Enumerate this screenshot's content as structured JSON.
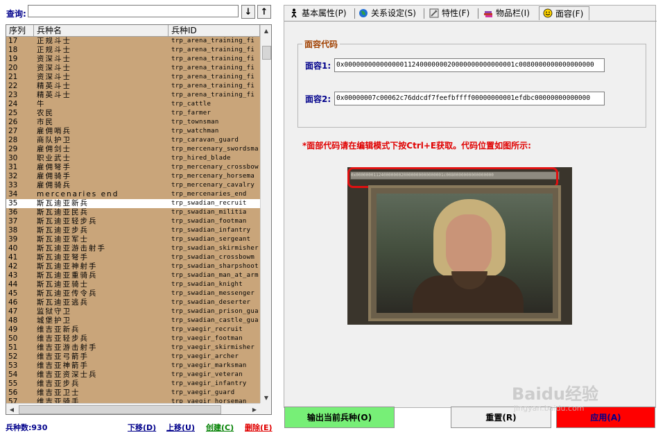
{
  "search": {
    "label": "查询:",
    "value": "",
    "down_arrow": "↓",
    "up_arrow": "↑"
  },
  "table": {
    "headers": [
      "序列",
      "兵种名",
      "兵种ID"
    ],
    "selected_index": 35,
    "rows": [
      {
        "no": "17",
        "name": "正规斗士",
        "id": "trp_arena_training_fi"
      },
      {
        "no": "18",
        "name": "正规斗士",
        "id": "trp_arena_training_fi"
      },
      {
        "no": "19",
        "name": "资深斗士",
        "id": "trp_arena_training_fi"
      },
      {
        "no": "20",
        "name": "资深斗士",
        "id": "trp_arena_training_fi"
      },
      {
        "no": "21",
        "name": "资深斗士",
        "id": "trp_arena_training_fi"
      },
      {
        "no": "22",
        "name": "精英斗士",
        "id": "trp_arena_training_fi"
      },
      {
        "no": "23",
        "name": "精英斗士",
        "id": "trp_arena_training_fi"
      },
      {
        "no": "24",
        "name": "牛",
        "id": "trp_cattle"
      },
      {
        "no": "25",
        "name": "农民",
        "id": "trp_farmer"
      },
      {
        "no": "26",
        "name": "市民",
        "id": "trp_townsman"
      },
      {
        "no": "27",
        "name": "雇佣哨兵",
        "id": "trp_watchman"
      },
      {
        "no": "28",
        "name": "商队护卫",
        "id": "trp_caravan_guard"
      },
      {
        "no": "29",
        "name": "雇佣剑士",
        "id": "trp_mercenary_swordsma"
      },
      {
        "no": "30",
        "name": "职业武士",
        "id": "trp_hired_blade"
      },
      {
        "no": "31",
        "name": "雇佣弩手",
        "id": "trp_mercenary_crossbow"
      },
      {
        "no": "32",
        "name": "雇佣骑手",
        "id": "trp_mercenary_horsema"
      },
      {
        "no": "33",
        "name": "雇佣骑兵",
        "id": "trp_mercenary_cavalry"
      },
      {
        "no": "34",
        "name": "mercenaries end",
        "id": "trp_mercenaries_end"
      },
      {
        "no": "35",
        "name": "斯瓦迪亚新兵",
        "id": "trp_swadian_recruit"
      },
      {
        "no": "36",
        "name": "斯瓦迪亚民兵",
        "id": "trp_swadian_militia"
      },
      {
        "no": "37",
        "name": "斯瓦迪亚轻步兵",
        "id": "trp_swadian_footman"
      },
      {
        "no": "38",
        "name": "斯瓦迪亚步兵",
        "id": "trp_swadian_infantry"
      },
      {
        "no": "39",
        "name": "斯瓦迪亚军士",
        "id": "trp_swadian_sergeant"
      },
      {
        "no": "40",
        "name": "斯瓦迪亚游击射手",
        "id": "trp_swadian_skirmisher"
      },
      {
        "no": "41",
        "name": "斯瓦迪亚弩手",
        "id": "trp_swadian_crossbowm"
      },
      {
        "no": "42",
        "name": "斯瓦迪亚神射手",
        "id": "trp_swadian_sharpshoot"
      },
      {
        "no": "43",
        "name": "斯瓦迪亚重骑兵",
        "id": "trp_swadian_man_at_arm"
      },
      {
        "no": "44",
        "name": "斯瓦迪亚骑士",
        "id": "trp_swadian_knight"
      },
      {
        "no": "45",
        "name": "斯瓦迪亚传令兵",
        "id": "trp_swadian_messenger"
      },
      {
        "no": "46",
        "name": "斯瓦迪亚逃兵",
        "id": "trp_swadian_deserter"
      },
      {
        "no": "47",
        "name": "监狱守卫",
        "id": "trp_swadian_prison_gua"
      },
      {
        "no": "48",
        "name": "城堡护卫",
        "id": "trp_swadian_castle_gua"
      },
      {
        "no": "49",
        "name": "维吉亚新兵",
        "id": "trp_vaegir_recruit"
      },
      {
        "no": "50",
        "name": "维吉亚轻步兵",
        "id": "trp_vaegir_footman"
      },
      {
        "no": "51",
        "name": "维吉亚游击射手",
        "id": "trp_vaegir_skirmisher"
      },
      {
        "no": "52",
        "name": "维吉亚弓箭手",
        "id": "trp_vaegir_archer"
      },
      {
        "no": "53",
        "name": "维吉亚神箭手",
        "id": "trp_vaegir_marksman"
      },
      {
        "no": "54",
        "name": "维吉亚资深士兵",
        "id": "trp_vaegir_veteran"
      },
      {
        "no": "55",
        "name": "维吉亚步兵",
        "id": "trp_vaegir_infantry"
      },
      {
        "no": "56",
        "name": "维吉亚卫士",
        "id": "trp_vaegir_guard"
      },
      {
        "no": "57",
        "name": "维吉亚骑手",
        "id": "trp_vaegir_horseman"
      }
    ]
  },
  "bottom": {
    "count_label": "兵种数:930",
    "move_down": "下移(D)",
    "move_up": "上移(U)",
    "create": "创建(C)",
    "delete": "删除(E)"
  },
  "tabs": [
    {
      "label": "基本属性(P)",
      "icon": "person-icon"
    },
    {
      "label": "关系设定(S)",
      "icon": "globe-icon"
    },
    {
      "label": "特性(F)",
      "icon": "tools-icon"
    },
    {
      "label": "物品栏(I)",
      "icon": "books-icon"
    },
    {
      "label": "面容(F)",
      "icon": "smiley-icon",
      "active": true
    }
  ],
  "face_panel": {
    "group_title": "面容代码",
    "face1_label": "面容1:",
    "face1_value": "0x0000000000000001124000000020000000000000001c0080000000000000000",
    "face2_label": "面容2:",
    "face2_value": "0x00000007c00062c76ddcdf7feefbffff00000000001efdbc00000000000000",
    "hint": "*面部代码请在编辑模式下按Ctrl+E获取。代码位置如图所示:",
    "image_code_strip": "0x00000001124000000020000000000000001c0080000000000000000"
  },
  "buttons": {
    "export": "输出当前兵种(O)",
    "reset": "重置(R)",
    "apply": "应用(A)"
  },
  "watermark": {
    "text": "Baidu经验",
    "url": "jingyan.baidu.com"
  },
  "colors": {
    "row_tan": "#c9a57a",
    "export_btn": "#77ef77",
    "apply_btn": "#ff0000",
    "label_blue": "#00008b",
    "hint_red": "#e00000"
  }
}
